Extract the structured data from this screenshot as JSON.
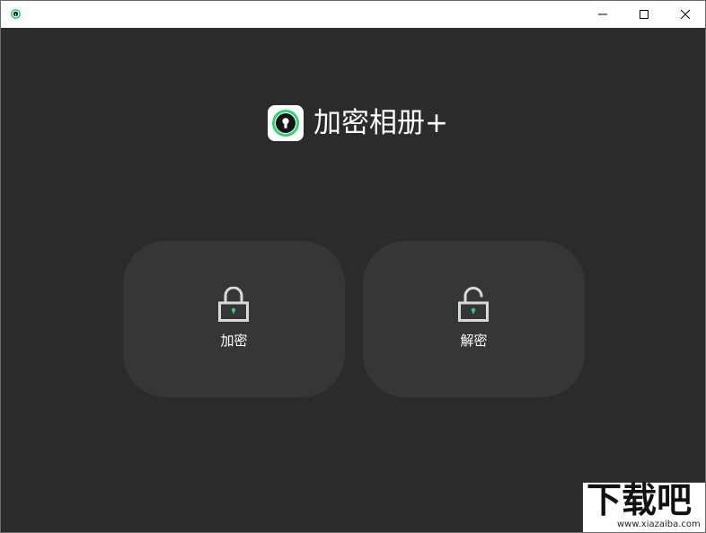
{
  "window": {
    "app_icon": "eye-lock-icon",
    "controls": {
      "minimize": "minimize-icon",
      "maximize": "maximize-icon",
      "close": "close-icon"
    }
  },
  "header": {
    "logo_icon": "keyhole-logo-icon",
    "title": "加密相册+",
    "accent_color": "#2ed573"
  },
  "actions": [
    {
      "label": "加密",
      "icon": "lock-closed-icon"
    },
    {
      "label": "解密",
      "icon": "lock-open-icon"
    }
  ],
  "watermark": {
    "text": "下载吧",
    "url": "www.xiazaiba.com"
  }
}
